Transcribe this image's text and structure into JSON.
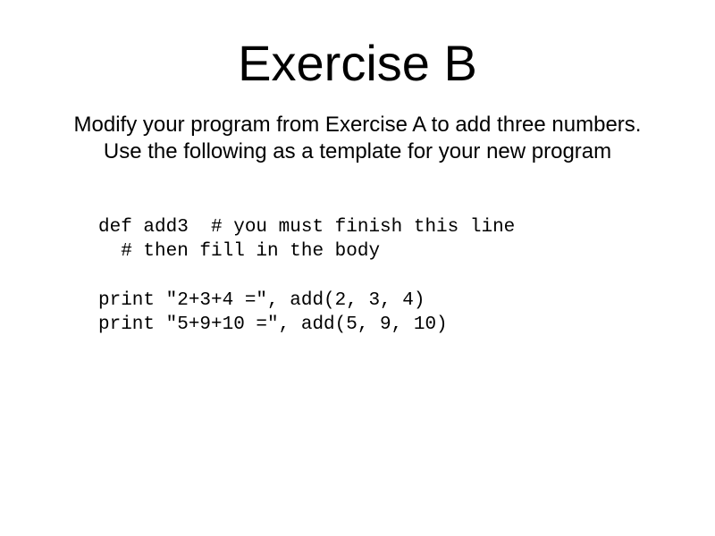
{
  "title": "Exercise B",
  "instructions": {
    "line1": "Modify your program from Exercise A to add three numbers.",
    "line2": "Use the following as a template for your new program"
  },
  "code": {
    "line1": "def add3  # you must finish this line",
    "line2": "  # then fill in the body",
    "line3": "",
    "line4": "print \"2+3+4 =\", add(2, 3, 4)",
    "line5": "print \"5+9+10 =\", add(5, 9, 10)"
  }
}
